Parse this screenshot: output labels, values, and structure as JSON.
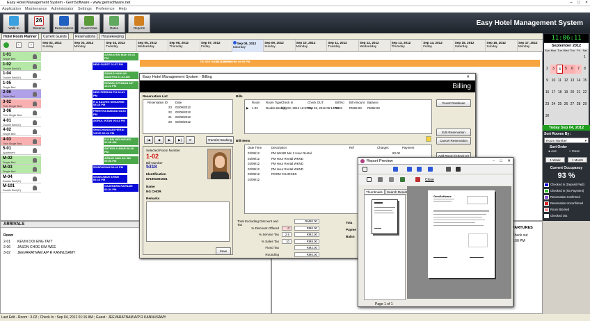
{
  "window": {
    "title": "Easy Hotel Management System - GemSoftware - www.gemsoftware.net"
  },
  "menu": [
    "Application",
    "Maintenance",
    "Administrator",
    "Settings",
    "Preference",
    "Help"
  ],
  "ribbon": {
    "buttons": [
      "Walk In",
      "Reserve",
      "Reservations",
      "Guest Data",
      "Rates",
      "Reports"
    ],
    "calendar_day": "26",
    "app_title": "Easy Hotel Management System"
  },
  "tabs": [
    "Hotel Room Planner",
    "Current Guests",
    "Reservations",
    "Housekeeping"
  ],
  "dates": [
    {
      "d": "Sep 02, 2012",
      "w": "Sunday"
    },
    {
      "d": "Sep 03, 2012",
      "w": "Monday"
    },
    {
      "d": "Sep 04, 2012",
      "w": "Tuesday"
    },
    {
      "d": "Sep 05, 2012",
      "w": "Wednesday"
    },
    {
      "d": "Sep 06, 2012",
      "w": "Thursday"
    },
    {
      "d": "Sep 07, 2012",
      "w": "Friday"
    },
    {
      "d": "Sep 08, 2012",
      "w": "Saturday"
    },
    {
      "d": "Sep 09, 2012",
      "w": "Sunday"
    },
    {
      "d": "Sep 10, 2012",
      "w": "Monday"
    },
    {
      "d": "Sep 11, 2012",
      "w": "Tuesday"
    },
    {
      "d": "Sep 12, 2012",
      "w": "Wednesday"
    },
    {
      "d": "Sep 13, 2012",
      "w": "Thursday"
    },
    {
      "d": "Sep 14, 2012",
      "w": "Friday"
    },
    {
      "d": "Sep 15, 2012",
      "w": "Saturday"
    },
    {
      "d": "Sep 16, 2012",
      "w": "Sunday"
    },
    {
      "d": "Sep 17, 2012",
      "w": "Monday"
    }
  ],
  "rooms": [
    {
      "n": "1-01",
      "t": "Single Bed",
      "c": "#b6e8a8"
    },
    {
      "n": "1-02",
      "t": "Double Bed (K)",
      "c": "#b6e8a8"
    },
    {
      "n": "1-04",
      "t": "Double Bed (K)",
      "c": "#fff"
    },
    {
      "n": "1-05",
      "t": "Single Bed",
      "c": "#fff"
    },
    {
      "n": "2-06",
      "t": "Triple Bed",
      "c": "#b0a0e8"
    },
    {
      "n": "3-02",
      "t": "Twin Single Bed",
      "c": "#f8b0b0"
    },
    {
      "n": "3-06",
      "t": "Twin Single Bed",
      "c": "#fff"
    },
    {
      "n": "4-01",
      "t": "Double Bed (K)",
      "c": "#fff"
    },
    {
      "n": "4-02",
      "t": "Single Bed",
      "c": "#fff"
    },
    {
      "n": "4-03",
      "t": "Twin Single Bed",
      "c": "#f8b0b0"
    },
    {
      "n": "5-01",
      "t": "Apartment",
      "c": "#fff"
    },
    {
      "n": "M-02",
      "t": "Single Bed",
      "c": "#b6e8a8"
    },
    {
      "n": "M-03",
      "t": "Single Bed",
      "c": "#b6e8a8"
    },
    {
      "n": "M-04",
      "t": "Double Bed (K)",
      "c": "#fff"
    },
    {
      "n": "M-101",
      "t": "Double Bed (K)",
      "c": "#fff"
    }
  ],
  "bookings": [
    {
      "row": 0,
      "txt": "AZWAN BIN MAH 05:21 PM",
      "cls": "co"
    },
    {
      "row": 1,
      "txt": "NEW GUEST 01:57 PM",
      "cls": "ch"
    },
    {
      "row": 2,
      "txt": "SAMAD HANI A/L SAMITHA 01:22 AM",
      "cls": "co"
    },
    {
      "row": 3,
      "txt": "RIZWAN UTHMAN A/P 11:21 PM",
      "cls": "co"
    },
    {
      "row": 4,
      "txt": "NEW PERSON PH 08:41 PM",
      "cls": "ch"
    },
    {
      "row": 5,
      "txt": "R A KACHIG NIVASHINI 08:16 PM",
      "cls": "ch"
    },
    {
      "row": 6,
      "txt": "PREETHA BAKASI 04:24 PM",
      "cls": "ch"
    },
    {
      "row": 7,
      "txt": "AGRUL INTAN 06:41 PM",
      "cls": "ch"
    },
    {
      "row": 8,
      "txt": "SHAICHANDANI HERAI VISVE 02:24 PM",
      "cls": "ch"
    },
    {
      "row": 9,
      "txt": "R A PAI HIG NIRVED 01:28 AM",
      "cls": "co"
    },
    {
      "row": 10,
      "txt": "SATHYA LUNAR 06:48 PM",
      "cls": "co"
    },
    {
      "row": 11,
      "txt": "AZNAH AWA A/L BA 09:08 PM",
      "cls": "co"
    },
    {
      "row": 12,
      "txt": "SIVAPAKIAM 06:40 PM",
      "cls": "ch"
    },
    {
      "row": 13,
      "txt": "SIVAKUMAR SHINE 06:10 PM",
      "cls": "ch"
    },
    {
      "row": 14,
      "txt": "GAJENDRA RATNAM 02:34 PM",
      "cls": "ch"
    }
  ],
  "top_orange": [
    "TIE SEE HUAT 11:01 PM",
    "TEL CHIEN KHIN 08:00 PM"
  ],
  "side": {
    "clock": "11:06:11",
    "month": "September 2012",
    "weekdays": [
      "Sun",
      "Mon",
      "Tue",
      "Wed",
      "Thu",
      "Fri",
      "Sat"
    ],
    "today": "Today Sep 04, 2012",
    "sort_label": "Sort Rooms By :",
    "sort_value": "Room Number",
    "sort_order": "Sort Order",
    "asc": "Asc",
    "desc": "Desc",
    "week": "1 Week",
    "month_btn": "1 Month",
    "occupancy_label": "Current Occupancy",
    "occupancy": "93 %",
    "legend": [
      {
        "t": "Checked In (Deposit Paid)",
        "c": "#0a0ad8"
      },
      {
        "t": "Checked In (No Payment)",
        "c": "#2ec02e"
      },
      {
        "t": "Reservation Confirmed",
        "c": "#8a4fd0"
      },
      {
        "t": "Reservation Unconfirmed",
        "c": "#e02020"
      },
      {
        "t": "Room Blocked",
        "c": "#ff8d8d"
      },
      {
        "t": "Checked Out",
        "c": "#fff"
      }
    ]
  },
  "arrivals": {
    "title": "ARRIVALS",
    "col": "Room",
    "col2": "Guest",
    "rows": [
      {
        "r": "2-01",
        "g": "KEVIN OOI ENG TATT"
      },
      {
        "r": "2-06",
        "g": "JASON CHOE KIM WEE"
      },
      {
        "r": "3-02",
        "g": "JEEVARATNAM A/P R KANNUSAMY"
      }
    ]
  },
  "departures": {
    "title": "PARTURES",
    "col": "Check out",
    "v": "2:00 PM"
  },
  "billing": {
    "title": "Easy Hotel Management System - Billing",
    "header": "Billing",
    "reslist_title": "Reservation List",
    "res_cols": [
      "Reservation ID",
      "Date"
    ],
    "res_rows": [
      {
        "id": "23",
        "d": "02/09/2012"
      },
      {
        "id": "22",
        "d": "02/09/2012"
      },
      {
        "id": "21",
        "d": "02/09/2012"
      },
      {
        "id": "20",
        "d": "02/09/2012"
      }
    ],
    "transfer": "Transfer Booking",
    "selected_label": "Selected Room Number",
    "room": "1-02",
    "billno_label": "Bill Number",
    "billno": "5318",
    "id_label": "Identification",
    "id": "871991001001",
    "name_label": "Name",
    "name": "NG CHOR",
    "remarks": "Remarks",
    "save": "Save",
    "bills_title": "Bills",
    "bill_cols": [
      "Room",
      "Room Type",
      "Check In",
      "Check OUT",
      "Bill No",
      "Bill Amount",
      "Balance"
    ],
    "bill_row": [
      "1-02",
      "Double Bed (K)",
      "Sep 02, 2012 12:57PM",
      "Sep 02, 2012 06:14PM",
      "5318",
      "RM92.00",
      "RM92.00"
    ],
    "items_title": "Bill Items",
    "item_cols": [
      "Date Time",
      "Description",
      "Ref",
      "Charges",
      "Payment"
    ],
    "items": [
      {
        "dt": "02/09/12",
        "ds": "PM WKND Min 3 Hour Rental",
        "ch": "80.00"
      },
      {
        "dt": "02/09/12",
        "ds": "PM Hour Rental WKND",
        "ch": ""
      },
      {
        "dt": "02/09/12",
        "ds": "PM Hour Rental WKND",
        "ch": ""
      },
      {
        "dt": "02/09/12",
        "ds": "PM Hour Rental WKND",
        "ch": ""
      },
      {
        "dt": "02/09/12",
        "ds": "ROOM CHARGES",
        "ch": "278.00"
      },
      {
        "dt": "02/09/12",
        "ds": "",
        "ch": ""
      }
    ],
    "totals": [
      {
        "l": "Total Excluding Discount and Tax",
        "v": "RM80.00",
        "p": ""
      },
      {
        "l": "% Discount Offered",
        "v": "RM0.00",
        "p": "0"
      },
      {
        "l": "% Service Tax",
        "v": "RM2.00",
        "p": "2.5"
      },
      {
        "l": "% Sales Tax",
        "v": "RM8.00",
        "p": "10"
      },
      {
        "l": "Fixed Tax",
        "v": "RM2.00",
        "p": ""
      },
      {
        "l": "Rounding",
        "v": "RM0.00",
        "p": ""
      }
    ],
    "right_labels": [
      "Tota",
      "Payme",
      "Balan"
    ],
    "buttons": [
      "Guest Database",
      "Edit Reservation",
      "Cancel Reservation",
      "Add Room (Check In)"
    ]
  },
  "report": {
    "title": "Report Preview",
    "close": "Close",
    "tabs": [
      "Thumbnails",
      "Search Results"
    ],
    "page": "Page 1 of 1",
    "company": "GemSoftware"
  },
  "status": "Last Edit - Room : 3-02 ; Check In : Sep 04, 2012 01:16 AM ; Guest : JEEVARATNAM A/P R KANNUSAMY"
}
